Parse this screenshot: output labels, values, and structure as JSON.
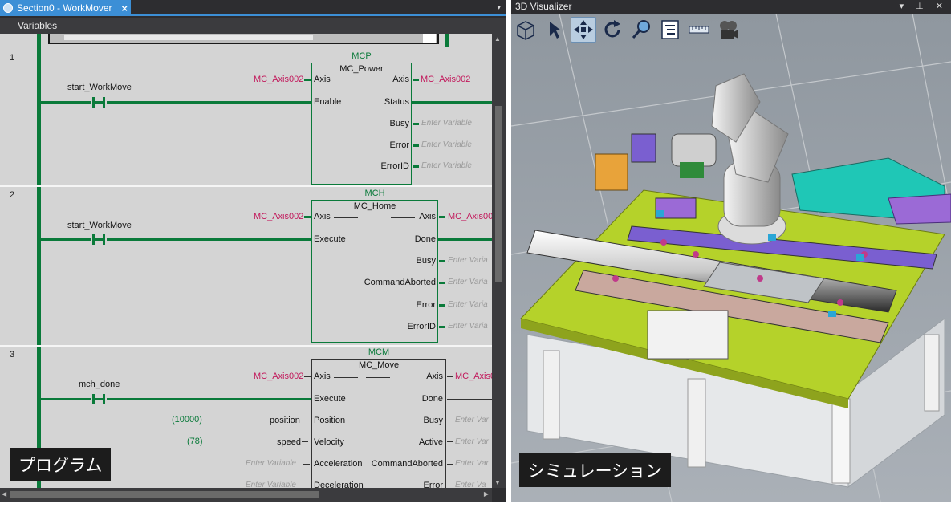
{
  "left_pane": {
    "tab_title": "Section0 - WorkMover",
    "tab_close": "×",
    "dropdown_glyph": "▾",
    "variables_header": "Variables",
    "overlay_label": "プログラム",
    "rungs": [
      {
        "number": "1",
        "contact": "start_WorkMove",
        "instance": "MCP",
        "block": "MC_Power",
        "inputs": [
          {
            "var": "MC_Axis002",
            "pin": "Axis"
          },
          {
            "var": "",
            "pin": "Enable"
          }
        ],
        "outputs": [
          {
            "pin": "Axis",
            "var": "MC_Axis002"
          },
          {
            "pin": "Status",
            "var": ""
          },
          {
            "pin": "Busy",
            "var": "Enter Variable"
          },
          {
            "pin": "Error",
            "var": "Enter Variable"
          },
          {
            "pin": "ErrorID",
            "var": "Enter Variable"
          }
        ]
      },
      {
        "number": "2",
        "contact": "start_WorkMove",
        "instance": "MCH",
        "block": "MC_Home",
        "inputs": [
          {
            "var": "MC_Axis002",
            "pin": "Axis"
          },
          {
            "var": "",
            "pin": "Execute"
          }
        ],
        "outputs": [
          {
            "pin": "Axis",
            "var": "MC_Axis00"
          },
          {
            "pin": "Done",
            "var": ""
          },
          {
            "pin": "Busy",
            "var": "Enter Varia"
          },
          {
            "pin": "CommandAborted",
            "var": "Enter Varia"
          },
          {
            "pin": "Error",
            "var": "Enter Varia"
          },
          {
            "pin": "ErrorID",
            "var": "Enter Varia"
          }
        ]
      },
      {
        "number": "3",
        "contact": "mch_done",
        "instance": "MCM",
        "block": "MC_Move",
        "inputs": [
          {
            "var": "MC_Axis002",
            "pin": "Axis"
          },
          {
            "var": "",
            "pin": "Execute"
          },
          {
            "var": "position",
            "value": "(10000)",
            "pin": "Position"
          },
          {
            "var": "speed",
            "value": "(78)",
            "pin": "Velocity"
          },
          {
            "var": "Enter Variable",
            "pin": "Acceleration"
          },
          {
            "var": "Enter Variable",
            "pin": "Deceleration"
          }
        ],
        "outputs": [
          {
            "pin": "Axis",
            "var": "MC_Axis0"
          },
          {
            "pin": "Done",
            "var": ""
          },
          {
            "pin": "Busy",
            "var": "Enter Var"
          },
          {
            "pin": "Active",
            "var": "Enter Var"
          },
          {
            "pin": "CommandAborted",
            "var": "Enter Var"
          },
          {
            "pin": "Error",
            "var": "Enter Va"
          }
        ]
      }
    ]
  },
  "right_pane": {
    "title": "3D Visualizer",
    "title_controls": "▾ ⊥ ✕",
    "overlay_label": "シミュレーション",
    "toolbar": [
      {
        "icon": "view-cube-icon"
      },
      {
        "icon": "select-arrow-icon"
      },
      {
        "icon": "pan-icon",
        "active": true
      },
      {
        "icon": "rotate-icon"
      },
      {
        "icon": "zoom-icon"
      },
      {
        "icon": "object-list-icon"
      },
      {
        "icon": "measure-icon"
      },
      {
        "icon": "record-video-icon"
      }
    ]
  },
  "colors": {
    "ladder_green": "#0a7a3a",
    "variable_red": "#c2185b",
    "tab_blue": "#3c8fd6",
    "ide_dark": "#2d2d30"
  }
}
